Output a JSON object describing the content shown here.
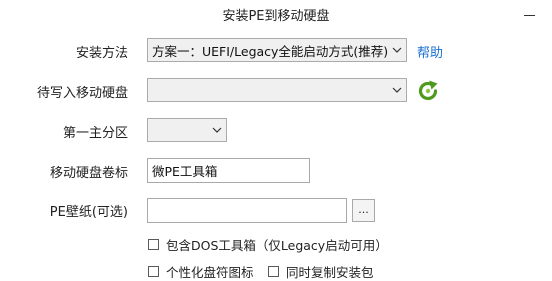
{
  "window": {
    "title": "安装PE到移动硬盘"
  },
  "form": {
    "install_method": {
      "label": "安装方法",
      "value": "方案一：UEFI/Legacy全能启动方式(推荐)",
      "help_link": "帮助"
    },
    "target_disk": {
      "label": "待写入移动硬盘",
      "value": ""
    },
    "first_partition": {
      "label": "第一主分区",
      "value": ""
    },
    "volume_label": {
      "label": "移动硬盘卷标",
      "value": "微PE工具箱"
    },
    "wallpaper": {
      "label": "PE壁纸(可选)",
      "value": "",
      "browse_label": "..."
    },
    "options": {
      "include_dos": "包含DOS工具箱（仅Legacy启动可用）",
      "personalize_icon": "个性化盘符图标",
      "copy_package": "同时复制安装包"
    }
  },
  "colors": {
    "link": "#1a6fd1",
    "refresh_icon": "#4e9a1e"
  }
}
